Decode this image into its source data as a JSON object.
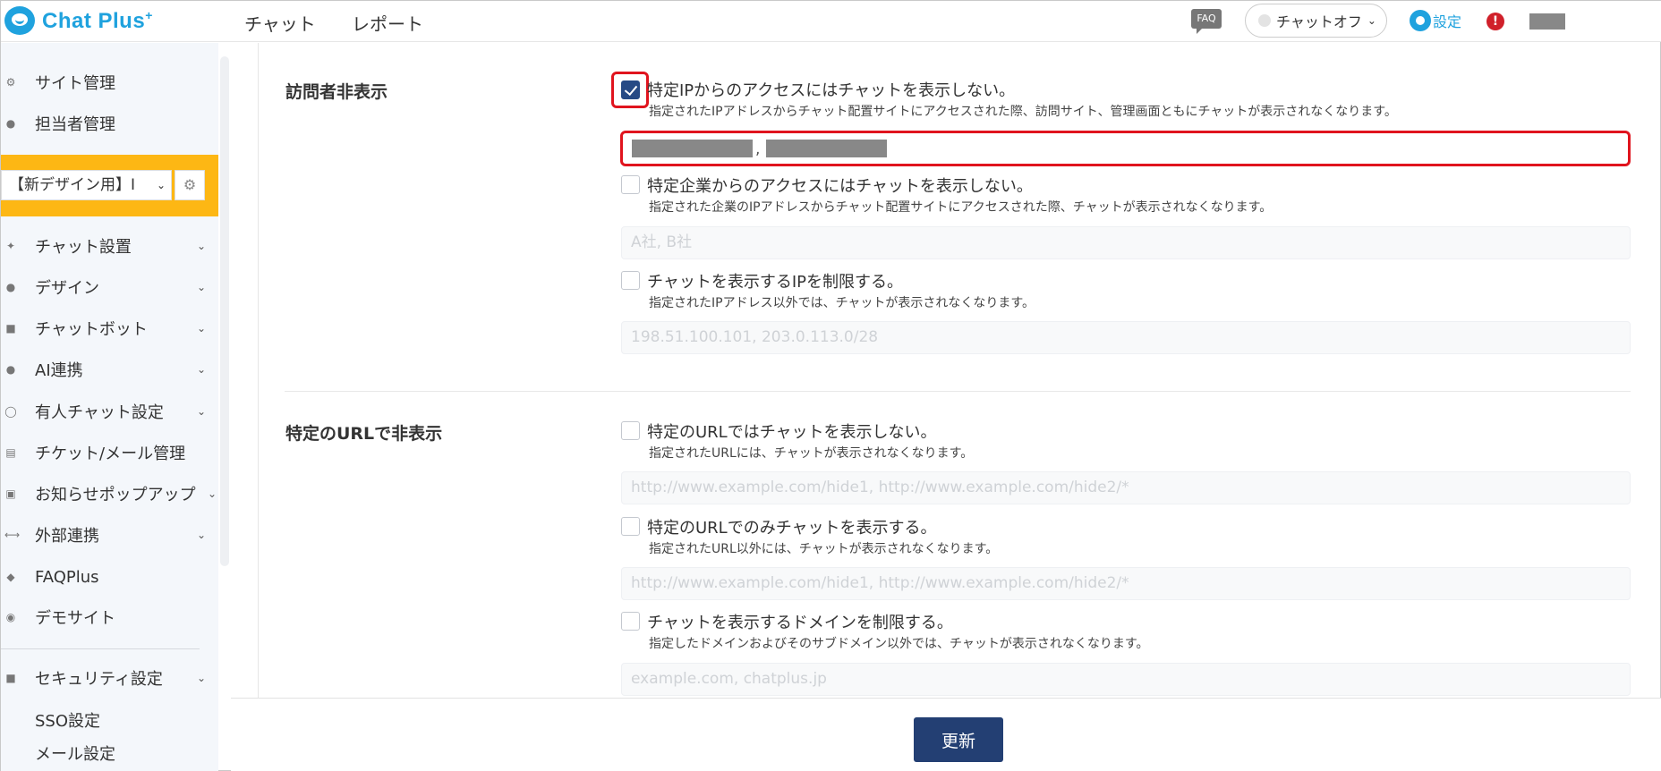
{
  "header": {
    "logo_text": "Chat Plus",
    "logo_sup": "+",
    "nav": [
      "チャット",
      "レポート"
    ],
    "faq_badge": "FAQ",
    "chat_toggle": "チャットオフ",
    "settings": "設定",
    "alert": "!"
  },
  "sidebar": {
    "items_top": [
      {
        "label": "サイト管理",
        "icon": "gear-icon"
      },
      {
        "label": "担当者管理",
        "icon": "users-icon"
      }
    ],
    "site_select": "【新デザイン用】I",
    "items": [
      {
        "label": "チャット設置",
        "icon": "wrench-icon",
        "has_chevron": true
      },
      {
        "label": "デザイン",
        "icon": "palette-icon",
        "has_chevron": true
      },
      {
        "label": "チャットボット",
        "icon": "chat-icon",
        "has_chevron": true
      },
      {
        "label": "AI連携",
        "icon": "lightbulb-icon",
        "has_chevron": true
      },
      {
        "label": "有人チャット設定",
        "icon": "headset-icon",
        "has_chevron": true
      },
      {
        "label": "チケット/メール管理",
        "icon": "ticket-icon",
        "has_chevron": false
      },
      {
        "label": "お知らせポップアップ",
        "icon": "popup-icon",
        "has_chevron": true
      },
      {
        "label": "外部連携",
        "icon": "share-icon",
        "has_chevron": true
      },
      {
        "label": "FAQPlus",
        "icon": "shield-icon",
        "has_chevron": false
      },
      {
        "label": "デモサイト",
        "icon": "demo-icon",
        "has_chevron": false
      }
    ],
    "security": {
      "label": "セキュリティ設定",
      "icon": "lock-icon"
    },
    "sub_items": [
      "SSO設定",
      "メール設定"
    ]
  },
  "main": {
    "visitor_section": {
      "title": "訪問者非表示",
      "options": [
        {
          "label": "特定IPからのアクセスにはチャットを表示しない。",
          "desc": "指定されたIPアドレスからチャット配置サイトにアクセスされた際、訪問サイト、管理画面ともにチャットが表示されなくなります。",
          "checked": true,
          "value_sep": ","
        },
        {
          "label": "特定企業からのアクセスにはチャットを表示しない。",
          "desc": "指定された企業のIPアドレスからチャット配置サイトにアクセスされた際、チャットが表示されなくなります。",
          "checked": false,
          "placeholder": "A社, B社"
        },
        {
          "label": "チャットを表示するIPを制限する。",
          "desc": "指定されたIPアドレス以外では、チャットが表示されなくなります。",
          "checked": false,
          "placeholder": "198.51.100.101, 203.0.113.0/28"
        }
      ]
    },
    "url_section": {
      "title": "特定のURLで非表示",
      "options": [
        {
          "label": "特定のURLではチャットを表示しない。",
          "desc": "指定されたURLには、チャットが表示されなくなります。",
          "checked": false,
          "placeholder": "http://www.example.com/hide1, http://www.example.com/hide2/*"
        },
        {
          "label": "特定のURLでのみチャットを表示する。",
          "desc": "指定されたURL以外には、チャットが表示されなくなります。",
          "checked": false,
          "placeholder": "http://www.example.com/hide1, http://www.example.com/hide2/*"
        },
        {
          "label": "チャットを表示するドメインを制限する。",
          "desc": "指定したドメインおよびそのサブドメイン以外では、チャットが表示されなくなります。",
          "checked": false,
          "placeholder": "example.com, chatplus.jp"
        }
      ]
    }
  },
  "footer": {
    "update_label": "更新"
  },
  "colors": {
    "brand": "#1fa2de",
    "accent": "#264a85",
    "highlight": "#e0141e",
    "site_select_bg": "#fdb714"
  }
}
